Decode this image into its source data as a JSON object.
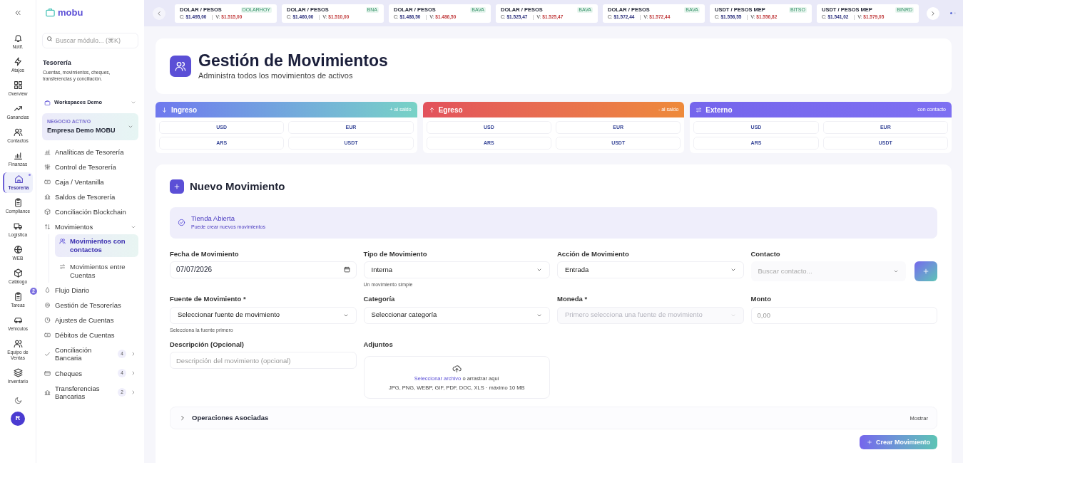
{
  "rail": {
    "items": [
      {
        "label": "Notif.",
        "selected": false
      },
      {
        "label": "Atajos",
        "selected": false
      },
      {
        "label": "Overview",
        "selected": false
      },
      {
        "label": "Ganancias",
        "selected": false
      },
      {
        "label": "Contactos",
        "selected": false
      },
      {
        "label": "Finanzas",
        "selected": false
      },
      {
        "label": "Tesorería",
        "selected": true
      },
      {
        "label": "Compliance",
        "selected": false
      },
      {
        "label": "Logística",
        "selected": false
      },
      {
        "label": "WEB",
        "selected": false
      },
      {
        "label": "Catálogo",
        "selected": false
      },
      {
        "label": "Tareas",
        "selected": false,
        "badge": "2"
      },
      {
        "label": "Vehículos",
        "selected": false
      },
      {
        "label": "Equipo de Ventas",
        "selected": false
      },
      {
        "label": "Inventario",
        "selected": false
      }
    ],
    "avatar": "R"
  },
  "sidebar": {
    "logo": "mobu",
    "search": {
      "placeholder": "Buscar módulo... (⌘K)"
    },
    "title": "Tesorería",
    "description": "Cuentas, movimientos, cheques, transferencias y conciliación.",
    "workspace": "Workspaces Demo",
    "business": {
      "label": "NEGOCIO ACTIVO",
      "name": "Empresa Demo MOBU"
    },
    "items": [
      {
        "label": "Analíticas de Tesorería",
        "selected": false
      },
      {
        "label": "Control de Tesorería",
        "selected": false
      },
      {
        "label": "Caja / Ventanilla",
        "selected": false
      },
      {
        "label": "Saldos de Tesorería",
        "selected": false
      },
      {
        "label": "Conciliación Blockchain",
        "selected": false
      },
      {
        "label": "Movimientos",
        "selected": false,
        "expanded": true,
        "children": [
          {
            "label": "Movimientos con contactos",
            "selected": true
          },
          {
            "label": "Movimientos entre Cuentas",
            "selected": false
          }
        ]
      },
      {
        "label": "Flujo Diario",
        "selected": false
      },
      {
        "label": "Gestión de Tesorerías",
        "selected": false
      },
      {
        "label": "Ajustes de Cuentas",
        "selected": false
      },
      {
        "label": "Débitos de Cuentas",
        "selected": false
      },
      {
        "label": "Conciliación Bancaria",
        "selected": false,
        "count": "4"
      },
      {
        "label": "Cheques",
        "selected": false,
        "count": "4"
      },
      {
        "label": "Transferencias Bancarias",
        "selected": false,
        "count": "2"
      }
    ]
  },
  "ticker": {
    "quotes": [
      {
        "pair": "DOLAR / PESOS",
        "source": "DOLARHOY",
        "buy_label": "C:",
        "buy": "$1.495,00",
        "sell_label": "V:",
        "sell": "$1.515,00"
      },
      {
        "pair": "DOLAR / PESOS",
        "source": "BNA",
        "buy_label": "C:",
        "buy": "$1.460,00",
        "sell_label": "V:",
        "sell": "$1.510,00"
      },
      {
        "pair": "DOLAR / PESOS",
        "source": "BAVA",
        "buy_label": "C:",
        "buy": "$1.486,50",
        "sell_label": "V:",
        "sell": "$1.486,50"
      },
      {
        "pair": "DOLAR / PESOS",
        "source": "BAVA",
        "buy_label": "C:",
        "buy": "$1.525,47",
        "sell_label": "V:",
        "sell": "$1.525,47"
      },
      {
        "pair": "DOLAR / PESOS",
        "source": "BAVA",
        "buy_label": "C:",
        "buy": "$1.572,44",
        "sell_label": "V:",
        "sell": "$1.572,44"
      },
      {
        "pair": "USDT / PESOS MEP",
        "source": "BITSO",
        "buy_label": "C:",
        "buy": "$1.556,55",
        "sell_label": "V:",
        "sell": "$1.556,82"
      },
      {
        "pair": "USDT / PESOS MEP",
        "source": "BINRD",
        "buy_label": "C:",
        "buy": "$1.541,02",
        "sell_label": "V:",
        "sell": "$1.579,05"
      }
    ],
    "pages": [
      {
        "selected": true
      },
      {
        "selected": false
      }
    ]
  },
  "header": {
    "title": "Gestión de Movimientos",
    "subtitle": "Administra todos los movimientos de activos"
  },
  "type_cards": [
    {
      "kind": "ingreso",
      "title": "Ingreso",
      "note": "+ al saldo",
      "currencies": [
        "USD",
        "EUR",
        "ARS",
        "USDT"
      ]
    },
    {
      "kind": "egreso",
      "title": "Egreso",
      "note": "- al saldo",
      "currencies": [
        "USD",
        "EUR",
        "ARS",
        "USDT"
      ]
    },
    {
      "kind": "externo",
      "title": "Externo",
      "note": "con contacto",
      "currencies": [
        "USD",
        "EUR",
        "ARS",
        "USDT"
      ]
    }
  ],
  "form": {
    "title": "Nuevo Movimiento",
    "status": {
      "title": "Tienda Abierta",
      "text": "Puede crear nuevos movimientos"
    },
    "fields": [
      {
        "kind": "date",
        "label": "Fecha de Movimiento",
        "value": "07/07/2026"
      },
      {
        "kind": "select",
        "label": "Tipo de Movimiento",
        "value": "Interna",
        "hint": "Un movimiento simple",
        "disabled": false
      },
      {
        "kind": "select",
        "label": "Acción de Movimiento",
        "value": "Entrada",
        "disabled": false
      },
      {
        "kind": "contact",
        "label": "Contacto",
        "placeholder": "Buscar contacto..."
      },
      {
        "kind": "select",
        "label": "Fuente de Movimiento *",
        "value": "Seleccionar fuente de movimiento",
        "hint": "Selecciona la fuente primero",
        "disabled": false
      },
      {
        "kind": "select",
        "label": "Categoría",
        "value": "Seleccionar categoría",
        "disabled": false
      },
      {
        "kind": "select",
        "label": "Moneda *",
        "placeholder": "Primero selecciona una fuente de movimiento",
        "disabled": true
      },
      {
        "kind": "text",
        "label": "Monto",
        "placeholder": "0,00"
      },
      {
        "kind": "text",
        "label": "Descripción (Opcional)",
        "placeholder": "Descripción del movimiento (opcional)"
      },
      {
        "kind": "upload",
        "label": "Adjuntos",
        "link": "Seleccionar archivo",
        "text": "o arrastrar aquí",
        "formats": "JPG, PNG, WEBP, GIF, PDF, DOC, XLS · máximo 10 MB"
      }
    ],
    "related": {
      "title": "Operaciones Asociadas",
      "action": "Mostrar",
      "expanded": false
    },
    "submit": "Crear Movimiento"
  }
}
